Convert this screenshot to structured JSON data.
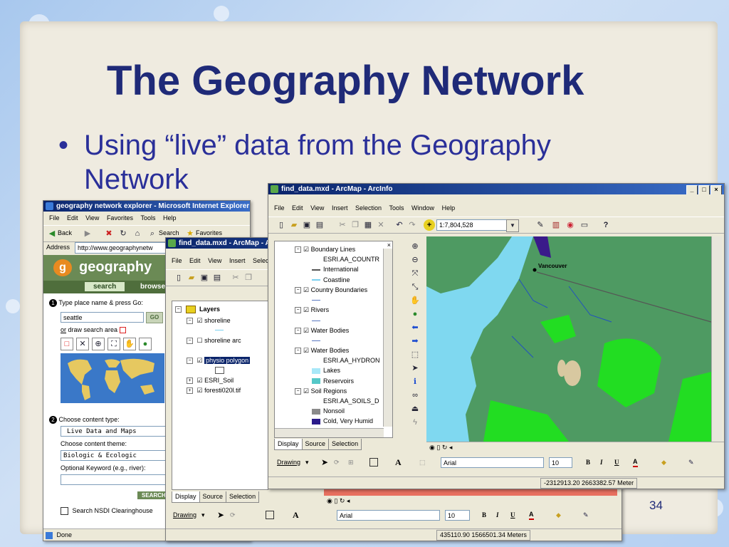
{
  "slide": {
    "title": "The Geography Network",
    "bullet_dot": "•",
    "bullet_text": "Using “live” data from the Geography Network",
    "page_number": "34"
  },
  "ie": {
    "title": "geography network explorer - Microsoft Internet Explorer",
    "menu": [
      "File",
      "Edit",
      "View",
      "Favorites",
      "Tools",
      "Help"
    ],
    "back_label": "Back",
    "search_label": "Search",
    "favorites_label": "Favorites",
    "address_label": "Address",
    "address_value": "http://www.geographynetw",
    "logo_letter": "g",
    "logo_text": "geography",
    "nav_search": "search",
    "nav_browse": "browse",
    "step1_num": "1",
    "step1_label": "Type place name & press Go:",
    "place_value": "seattle",
    "go_label": "GO",
    "draw_or": "or",
    "draw_label": "draw search area",
    "step2_num": "2",
    "step2_label": "Choose content type:",
    "content_type_value": "Live Data and Maps",
    "theme_label": "Choose content theme:",
    "theme_value": "Biologic & Ecologic",
    "keyword_label": "Optional Keyword (e.g., river):",
    "search_button": "SEARCH",
    "nsdi_label": "Search NSDI Clearinghouse",
    "status_text": "Done"
  },
  "arcmap_back": {
    "title": "find_data.mxd - ArcMap - A",
    "menu": [
      "File",
      "Edit",
      "View",
      "Insert",
      "Select"
    ],
    "layers_root": "Layers",
    "layers": [
      {
        "name": "shoreline",
        "checked": "☑"
      },
      {
        "name": "shoreline arc",
        "checked": "☐"
      },
      {
        "name": "physio polygon",
        "checked": "☑"
      },
      {
        "name": "ESRI_Soil",
        "checked": "☑"
      },
      {
        "name": "foresti020l.tif",
        "checked": "☑"
      }
    ],
    "tabs": [
      "Display",
      "Source",
      "Selection"
    ],
    "drawing_label": "Drawing",
    "font_name": "Arial",
    "font_size": "10",
    "coords": "435110.90  1566501.34 Meters"
  },
  "arcmap_front": {
    "title": "find_data.mxd - ArcMap - ArcInfo",
    "menu": [
      "File",
      "Edit",
      "View",
      "Insert",
      "Selection",
      "Tools",
      "Window",
      "Help"
    ],
    "scale_value": "1:7,804,528",
    "toc": [
      {
        "kind": "group",
        "name": "Boundary Lines",
        "checked": "☑"
      },
      {
        "kind": "text",
        "name": "ESRI.AA_COUNTR"
      },
      {
        "kind": "line",
        "name": "International",
        "color": "#555555"
      },
      {
        "kind": "line",
        "name": "Coastline",
        "color": "#7ad0f0"
      },
      {
        "kind": "group",
        "name": "Country Boundaries",
        "checked": "☑"
      },
      {
        "kind": "blank",
        "name": ""
      },
      {
        "kind": "group",
        "name": "Rivers",
        "checked": "☑"
      },
      {
        "kind": "blank",
        "name": ""
      },
      {
        "kind": "group",
        "name": "Water Bodies",
        "checked": "☑"
      },
      {
        "kind": "blank",
        "name": ""
      },
      {
        "kind": "group",
        "name": "Water Bodies",
        "checked": "☑"
      },
      {
        "kind": "text",
        "name": "ESRI.AA_HYDRON"
      },
      {
        "kind": "swatch",
        "name": "Lakes",
        "color": "#a8e8f8"
      },
      {
        "kind": "swatch",
        "name": "Reservoirs",
        "color": "#55c8c8"
      },
      {
        "kind": "group",
        "name": "Soil Regions",
        "checked": "☑"
      },
      {
        "kind": "text",
        "name": "ESRI.AA_SOILS_D"
      },
      {
        "kind": "swatch",
        "name": "Nonsoil",
        "color": "#8a8a8a"
      },
      {
        "kind": "swatch",
        "name": "Cold, Very Humid",
        "color": "#2a1a8a"
      }
    ],
    "tabs": [
      "Display",
      "Source",
      "Selection"
    ],
    "map_label_vancouver": "Vancouver",
    "drawing_label": "Drawing",
    "font_name": "Arial",
    "font_size": "10",
    "coords": "-2312913.20  2663382.57 Meter",
    "colors": {
      "water": "#7fd8f0",
      "land": "#4e9a62",
      "soil_green": "#22dd22",
      "tan": "#d8c8a0"
    }
  }
}
